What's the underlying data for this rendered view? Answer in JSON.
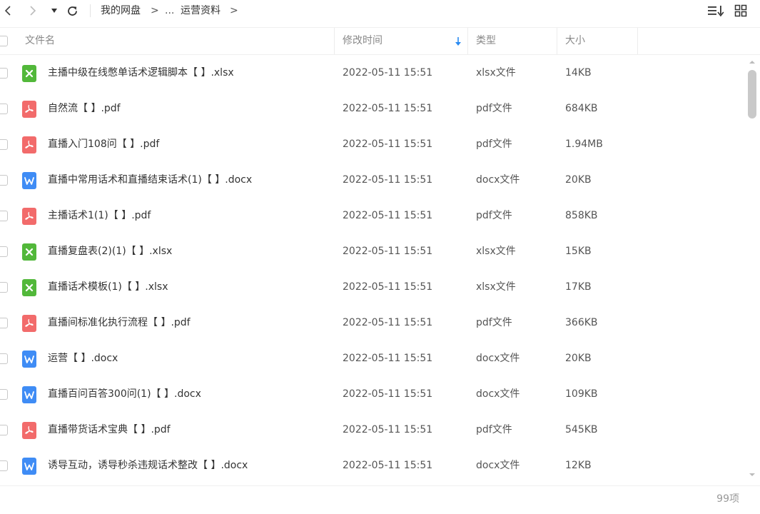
{
  "breadcrumb": {
    "root": "我的网盘",
    "sep": ">",
    "ellipsis": "...",
    "current": "运营资料",
    "sep_end": ">"
  },
  "columns": {
    "name": "文件名",
    "time": "修改时间",
    "type": "类型",
    "size": "大小"
  },
  "colors": {
    "xlsx": "#52b83a",
    "pdf": "#f26b6b",
    "docx": "#3f8cf5",
    "sort_arrow": "#2a8bf2"
  },
  "files": [
    {
      "name": "主播中级在线憋单话术逻辑脚本【 】.xlsx",
      "time": "2022-05-11 15:51",
      "type": "xlsx文件",
      "size": "14KB",
      "icon": "xlsx-icon"
    },
    {
      "name": "自然流【 】.pdf",
      "time": "2022-05-11 15:51",
      "type": "pdf文件",
      "size": "684KB",
      "icon": "pdf-icon"
    },
    {
      "name": "直播入门108问【 】.pdf",
      "time": "2022-05-11 15:51",
      "type": "pdf文件",
      "size": "1.94MB",
      "icon": "pdf-icon"
    },
    {
      "name": "直播中常用话术和直播结束话术(1)【 】.docx",
      "time": "2022-05-11 15:51",
      "type": "docx文件",
      "size": "20KB",
      "icon": "docx-icon"
    },
    {
      "name": "主播话术1(1)【 】.pdf",
      "time": "2022-05-11 15:51",
      "type": "pdf文件",
      "size": "858KB",
      "icon": "pdf-icon"
    },
    {
      "name": "直播复盘表(2)(1)【 】.xlsx",
      "time": "2022-05-11 15:51",
      "type": "xlsx文件",
      "size": "15KB",
      "icon": "xlsx-icon"
    },
    {
      "name": "直播话术模板(1)【 】.xlsx",
      "time": "2022-05-11 15:51",
      "type": "xlsx文件",
      "size": "17KB",
      "icon": "xlsx-icon"
    },
    {
      "name": "直播间标准化执行流程【 】.pdf",
      "time": "2022-05-11 15:51",
      "type": "pdf文件",
      "size": "366KB",
      "icon": "pdf-icon"
    },
    {
      "name": "运营【 】.docx",
      "time": "2022-05-11 15:51",
      "type": "docx文件",
      "size": "20KB",
      "icon": "docx-icon"
    },
    {
      "name": "直播百问百答300问(1)【 】.docx",
      "time": "2022-05-11 15:51",
      "type": "docx文件",
      "size": "109KB",
      "icon": "docx-icon"
    },
    {
      "name": "直播带货话术宝典【 】.pdf",
      "time": "2022-05-11 15:51",
      "type": "pdf文件",
      "size": "545KB",
      "icon": "pdf-icon"
    },
    {
      "name": "诱导互动，诱导秒杀违规话术整改【 】.docx",
      "time": "2022-05-11 15:51",
      "type": "docx文件",
      "size": "12KB",
      "icon": "docx-icon"
    }
  ],
  "footer": {
    "count": "99项"
  }
}
